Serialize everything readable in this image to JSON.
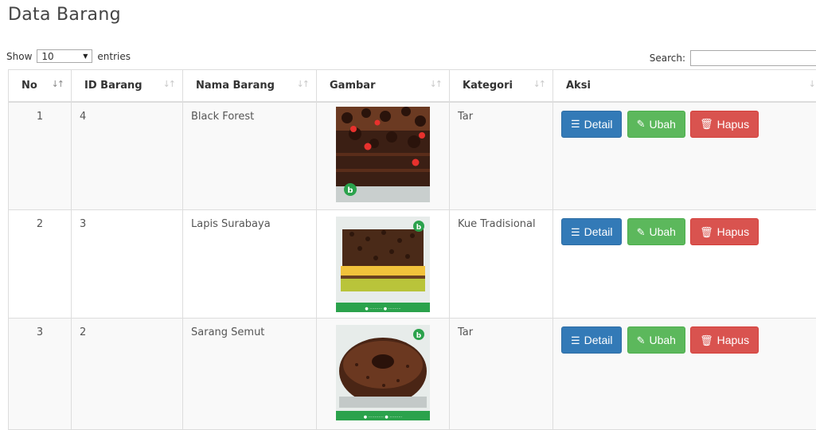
{
  "page": {
    "title": "Data Barang"
  },
  "controls": {
    "show_label": "Show",
    "length_value": "10",
    "entries_label": "entries",
    "search_label": "Search:",
    "search_value": ""
  },
  "table": {
    "headers": [
      "No",
      "ID Barang",
      "Nama Barang",
      "Gambar",
      "Kategori",
      "Aksi"
    ],
    "rows": [
      {
        "no": "1",
        "id": "4",
        "nama": "Black Forest",
        "gambar": "black-forest-cake-image",
        "kategori": "Tar"
      },
      {
        "no": "2",
        "id": "3",
        "nama": "Lapis Surabaya",
        "gambar": "lapis-surabaya-cake-image",
        "kategori": "Kue Tradisional"
      },
      {
        "no": "3",
        "id": "2",
        "nama": "Sarang Semut",
        "gambar": "sarang-semut-cake-image",
        "kategori": "Tar"
      }
    ]
  },
  "actions": {
    "detail_label": "Detail",
    "ubah_label": "Ubah",
    "hapus_label": "Hapus"
  },
  "icons": {
    "sort": "sort-arrows-icon",
    "detail": "list-icon",
    "ubah": "edit-icon",
    "hapus": "trash-icon",
    "dropdown": "dropdown-arrow-icon"
  },
  "colors": {
    "detail": "#337ab7",
    "ubah": "#5cb85c",
    "hapus": "#d9534f",
    "row_stripe": "#f9f9f9"
  }
}
